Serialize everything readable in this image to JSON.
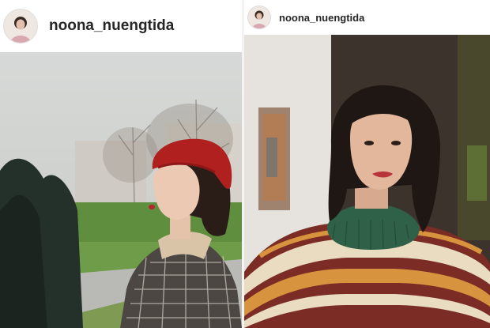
{
  "posts": [
    {
      "username": "noona_nuengtida",
      "avatar_icon": "profile-avatar",
      "photo": "photo of woman in red beret and plaid coat in a park"
    },
    {
      "username": "noona_nuengtida",
      "avatar_icon": "profile-avatar",
      "photo": "close-up portrait of woman in striped sweater"
    }
  ],
  "colors": {
    "username_text": "#262626",
    "background": "#ffffff"
  }
}
